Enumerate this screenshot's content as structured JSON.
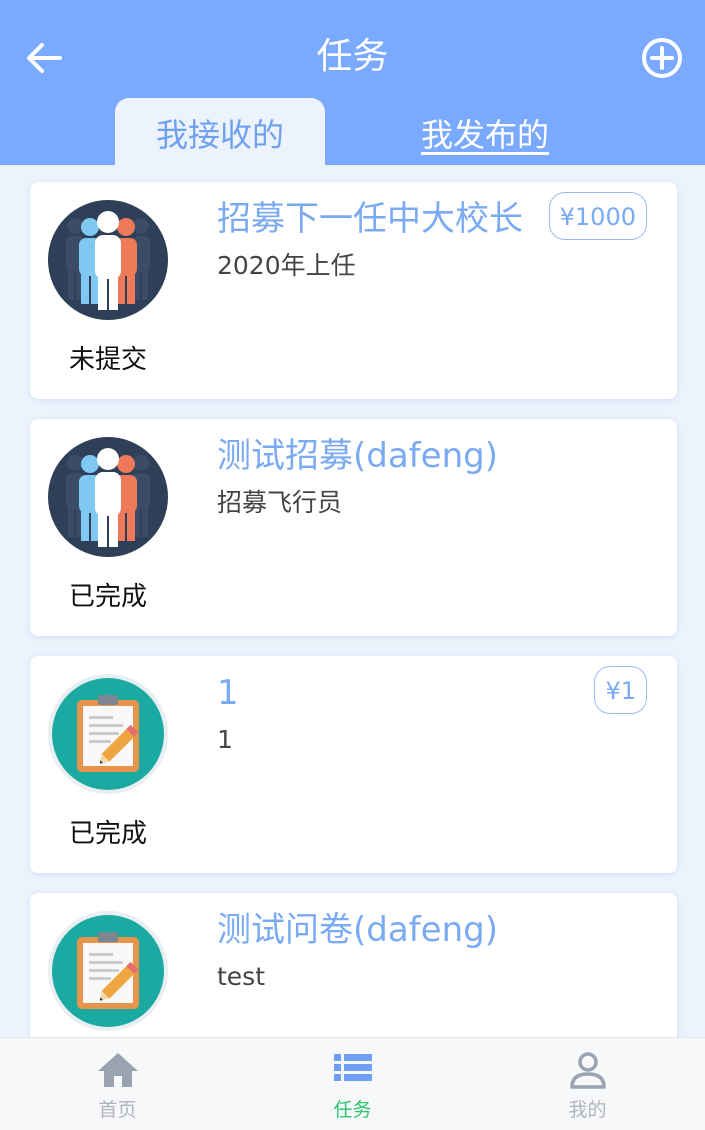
{
  "header": {
    "title": "任务",
    "tabs": [
      {
        "label": "我接收的",
        "active": true
      },
      {
        "label": "我发布的",
        "active": false
      }
    ],
    "back_icon": "arrow-left-icon",
    "add_icon": "plus-circle-icon"
  },
  "tasks": [
    {
      "title": "招募下一任中大校长",
      "description": "2020年上任",
      "price": "¥1000",
      "status": "未提交",
      "icon": "people-group-icon"
    },
    {
      "title": "测试招募(dafeng)",
      "description": "招募飞行员",
      "price": "",
      "status": "已完成",
      "icon": "people-group-icon"
    },
    {
      "title": "1",
      "description": "1",
      "price": "¥1",
      "status": "已完成",
      "icon": "clipboard-pencil-icon"
    },
    {
      "title": "测试问卷(dafeng)",
      "description": "test",
      "price": "",
      "status": "",
      "icon": "clipboard-pencil-icon"
    }
  ],
  "bottom_nav": [
    {
      "label": "首页",
      "icon": "home-icon",
      "active": false
    },
    {
      "label": "任务",
      "icon": "list-icon",
      "active": true
    },
    {
      "label": "我的",
      "icon": "user-icon",
      "active": false
    }
  ],
  "colors": {
    "header": "#7aaaff",
    "accent_text": "#7aaaf2",
    "active_nav": "#2ec46e",
    "background": "#ecf3fd"
  }
}
